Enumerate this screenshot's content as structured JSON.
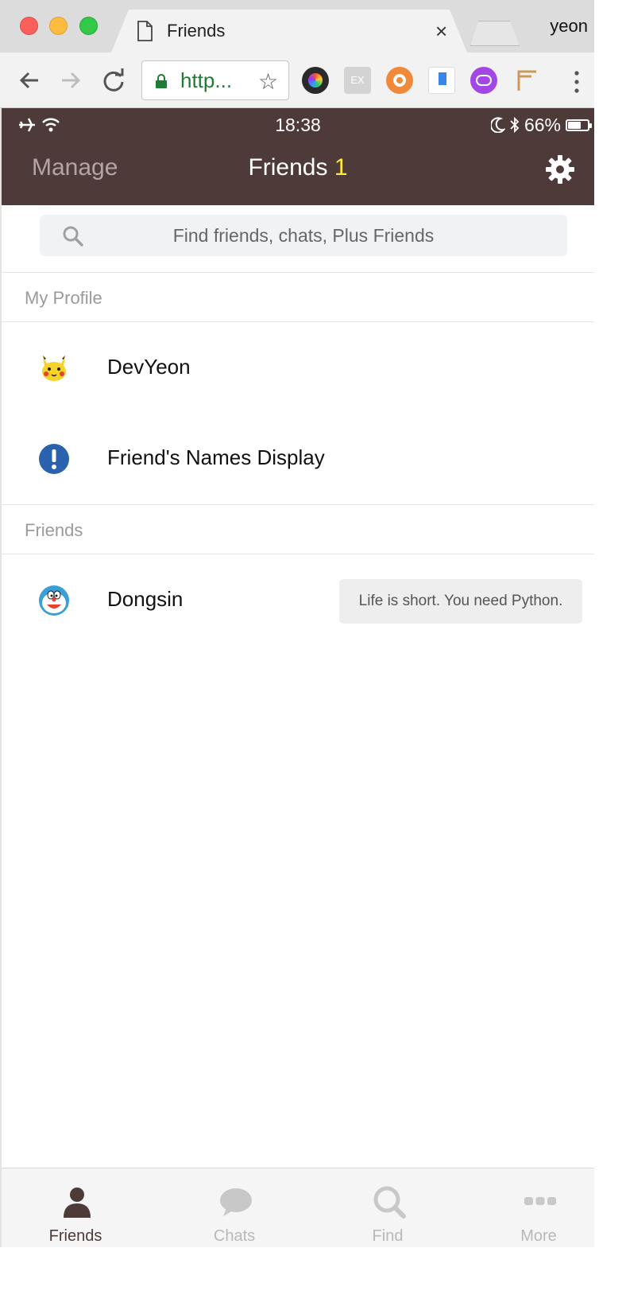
{
  "browser": {
    "tab_title": "Friends",
    "tab_close": "×",
    "profile_name": "yeon",
    "url": "http...",
    "star_glyph": "☆"
  },
  "phone_status": {
    "time": "18:38",
    "battery": "66%",
    "battery_level": 0.66
  },
  "header": {
    "manage_label": "Manage",
    "title": "Friends",
    "count": "1"
  },
  "search": {
    "placeholder": "Find friends, chats, Plus Friends"
  },
  "sections": {
    "my_profile": "My Profile",
    "friends": "Friends"
  },
  "my_profile": [
    {
      "name": "DevYeon",
      "icon": "pikachu-avatar-icon"
    },
    {
      "name": "Friend's Names Display",
      "icon": "exclamation-info-icon"
    }
  ],
  "friends": [
    {
      "name": "Dongsin",
      "icon": "doraemon-avatar-icon",
      "status": "Life is short. You need Python."
    }
  ],
  "tabbar": [
    {
      "label": "Friends",
      "icon": "person-icon",
      "active": true
    },
    {
      "label": "Chats",
      "icon": "speech-bubble-icon",
      "active": false
    },
    {
      "label": "Find",
      "icon": "search-icon",
      "active": false
    },
    {
      "label": "More",
      "icon": "more-dots-icon",
      "active": false
    }
  ],
  "colors": {
    "header_bg": "#4e3a39",
    "count_accent": "#ffea3b",
    "search_bg": "#f1f2f4"
  }
}
